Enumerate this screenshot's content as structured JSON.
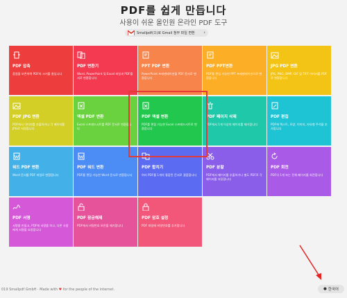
{
  "header": {
    "title": "PDF를 쉽게 만듭니다",
    "subtitle": "사용이 쉬운 올인원 온라인 PDF 도구",
    "gmail_label": "Smallpdf(으)로 Gmail 첨부 파일 변환"
  },
  "tools": [
    {
      "title": "PDF 압축",
      "desc": "품질을 보존하며 PDF의 크기를 줄입니다",
      "color": "#ee3d3d",
      "icon": "compress-icon"
    },
    {
      "title": "PDF 변환기",
      "desc": "Word, PowerPoint 및 Excel 파일과 PDF를 서로 변환합니다",
      "color": "#f43a51",
      "icon": "convert-icon"
    },
    {
      "title": "PPT PDF 변환",
      "desc": "PowerPoint 프레젠테이션을 PDF 문서로 변환합니다",
      "color": "#f7844b",
      "icon": "ppt-icon"
    },
    {
      "title": "PDF PPT변환",
      "desc": "PDF를 편집 가능한 PPT 프레젠테이션으로 변환합니다",
      "color": "#fbae26",
      "icon": "ppt-icon"
    },
    {
      "title": "JPG PDF 변환",
      "desc": "JPG, PNG, BMP, GIF 및 TIFF 이미지를 PDF로 변환합니다",
      "color": "#f3c416",
      "icon": "image-icon"
    },
    {
      "title": "PDF JPG 변환",
      "desc": "PDF에서 이미지를 추출하거나 각 페이지를 JPG로 저장합니다",
      "color": "#d4cf27",
      "icon": "image-icon"
    },
    {
      "title": "엑셀 PDF 변환",
      "desc": "Excel 스프레드시트를 PDF 문서로 변환합니다",
      "color": "#6ad23f",
      "icon": "excel-icon"
    },
    {
      "title": "PDF 엑셀 변환",
      "desc": "PDF를 편집 가능한 Excel 스프레드시트로 변환합니다",
      "color": "#22c84d",
      "icon": "excel-icon"
    },
    {
      "title": "PDF 페이지 삭제",
      "desc": "PDF에서 1개 이상의 페이지를 제거합니다",
      "color": "#1fc8a8",
      "icon": "trash-icon"
    },
    {
      "title": "PDF 편집",
      "desc": "PDF에 텍스트, 모양, 이미지, 자유형 주석을 추가합니다",
      "color": "#1fc4d4",
      "icon": "edit-icon"
    },
    {
      "title": "워드 PDF 변환",
      "desc": "Word 문서를 PDF 파일로 변환합니다",
      "color": "#43b1e8",
      "icon": "word-icon"
    },
    {
      "title": "PDF 워드 변환",
      "desc": "PDF를 편집 가능한 Word 문서로 변환합니다",
      "color": "#4c8cf5",
      "icon": "word-icon"
    },
    {
      "title": "PDF 합치기",
      "desc": "여러 PDF를 1개의 통합된 문서로 결합합니다",
      "color": "#5c6cf2",
      "icon": "merge-icon"
    },
    {
      "title": "PDF 분할",
      "desc": "PDF에서 페이지를 추출하거나 별도 PDF로 각 페이지를 저장합니다",
      "color": "#8a5ee8",
      "icon": "scissors-icon"
    },
    {
      "title": "PDF 회전",
      "desc": "PDF의 1개 또는 전체 페이지를 회전합니다",
      "color": "#a95ae6",
      "icon": "rotate-icon"
    },
    {
      "title": "PDF 서명",
      "desc": "서명을 만들고, PDF에 서명을 하고, 다른 사람에게 서명을 요청합니다",
      "color": "#d458d8",
      "icon": "sign-icon"
    },
    {
      "title": "PDF 잠금해제",
      "desc": "PDF에서 비밀번호 보안을 제거합니다",
      "color": "#e7539b",
      "icon": "unlock-icon"
    },
    {
      "title": "PDF 암호 설정",
      "desc": "PDF 파일에 비밀번호를 추가합니다",
      "color": "#f2577a",
      "icon": "lock-icon"
    }
  ],
  "footer": {
    "copyright": "019 Smallpdf GmbH",
    "made_with": "· Made with",
    "heart": "♥",
    "for_people": "for the people of the internet.",
    "language": "한국어"
  }
}
